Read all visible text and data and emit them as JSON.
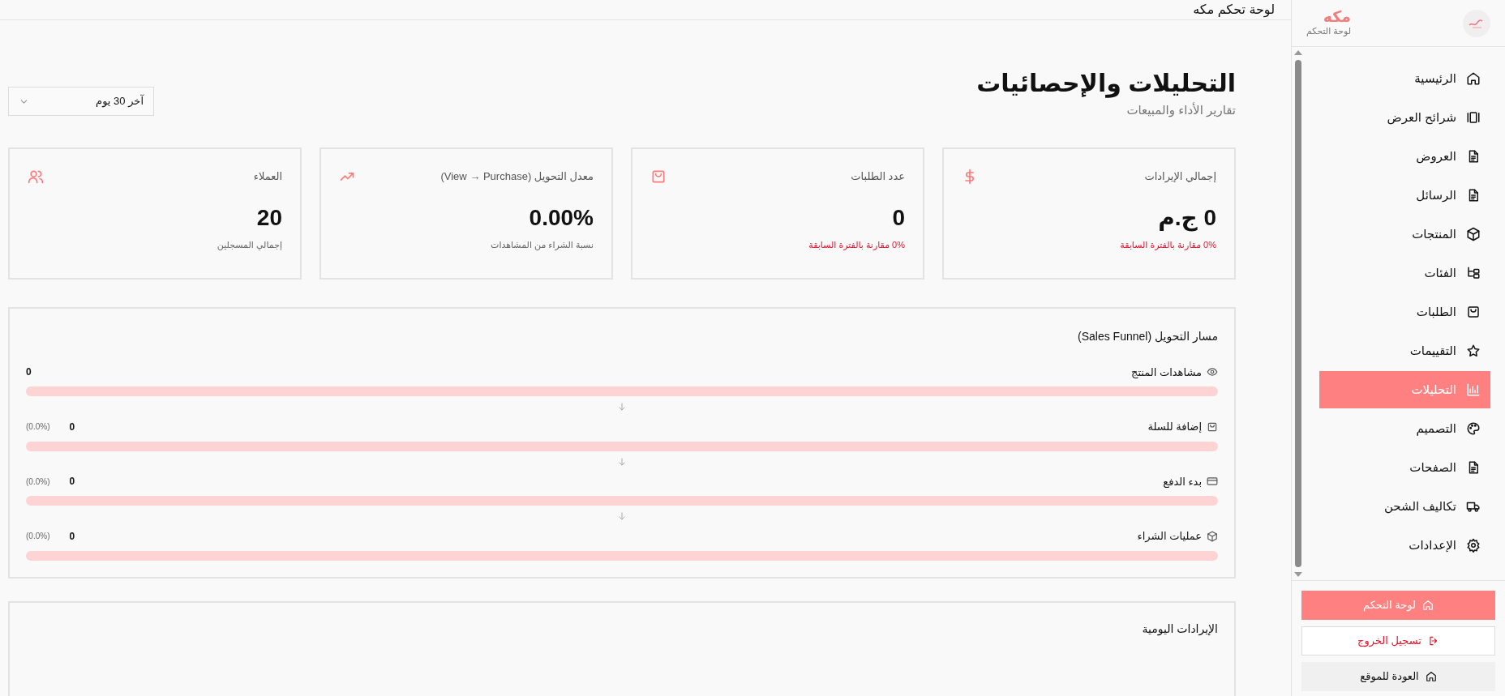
{
  "header": {
    "title": "لوحة تحكم مكه"
  },
  "sidebar": {
    "brand": "مكه",
    "subtitle": "لوحة التحكم",
    "items": [
      {
        "label": "الرئيسية",
        "selected": false
      },
      {
        "label": "شرائح العرض",
        "selected": false
      },
      {
        "label": "العروض",
        "selected": false
      },
      {
        "label": "الرسائل",
        "selected": false
      },
      {
        "label": "المنتجات",
        "selected": false
      },
      {
        "label": "الفئات",
        "selected": false
      },
      {
        "label": "الطلبات",
        "selected": false
      },
      {
        "label": "التقييمات",
        "selected": false
      },
      {
        "label": "التحليلات",
        "selected": true
      },
      {
        "label": "التصميم",
        "selected": false
      },
      {
        "label": "الصفحات",
        "selected": false
      },
      {
        "label": "تكاليف الشحن",
        "selected": false
      },
      {
        "label": "الإعدادات",
        "selected": false
      }
    ],
    "buttons": [
      {
        "label": "لوحة التحكم",
        "kind": "primary"
      },
      {
        "label": "تسجيل الخروج",
        "kind": "danger"
      },
      {
        "label": "العودة للموقع",
        "kind": "secondary"
      }
    ]
  },
  "page": {
    "title": "التحليلات والإحصائيات",
    "subtitle": "تقارير الأداء والمبيعات",
    "period": "آخر 30 يوم"
  },
  "stats": [
    {
      "label": "إجمالي الإيرادات",
      "value": "0 ج.م",
      "note": "0% مقارنة بالفترة السابقة",
      "kind": "change"
    },
    {
      "label": "عدد الطلبات",
      "value": "0",
      "note": "0% مقارنة بالفترة السابقة",
      "kind": "change"
    },
    {
      "label": "معدل التحويل (View → Purchase)",
      "value": "0.00%",
      "note": "نسبة الشراء من المشاهدات",
      "kind": "info"
    },
    {
      "label": "العملاء",
      "value": "20",
      "note": "إجمالي المسجلين",
      "kind": "info"
    }
  ],
  "funnel": {
    "title": "مسار التحويل (Sales Funnel)",
    "steps": [
      {
        "label": "مشاهدات المنتج",
        "count": "0",
        "level": 0
      },
      {
        "label": "إضافة للسلة",
        "count": "0",
        "percent": "(0.0%)",
        "level": 0
      },
      {
        "label": "بدء الدفع",
        "count": "0",
        "percent": "(0.0%)",
        "level": 0
      },
      {
        "label": "عمليات الشراء",
        "count": "0",
        "percent": "(0.0%)",
        "level": 0
      }
    ]
  },
  "daily_revenue": {
    "title": "الإيرادات اليومية"
  }
}
